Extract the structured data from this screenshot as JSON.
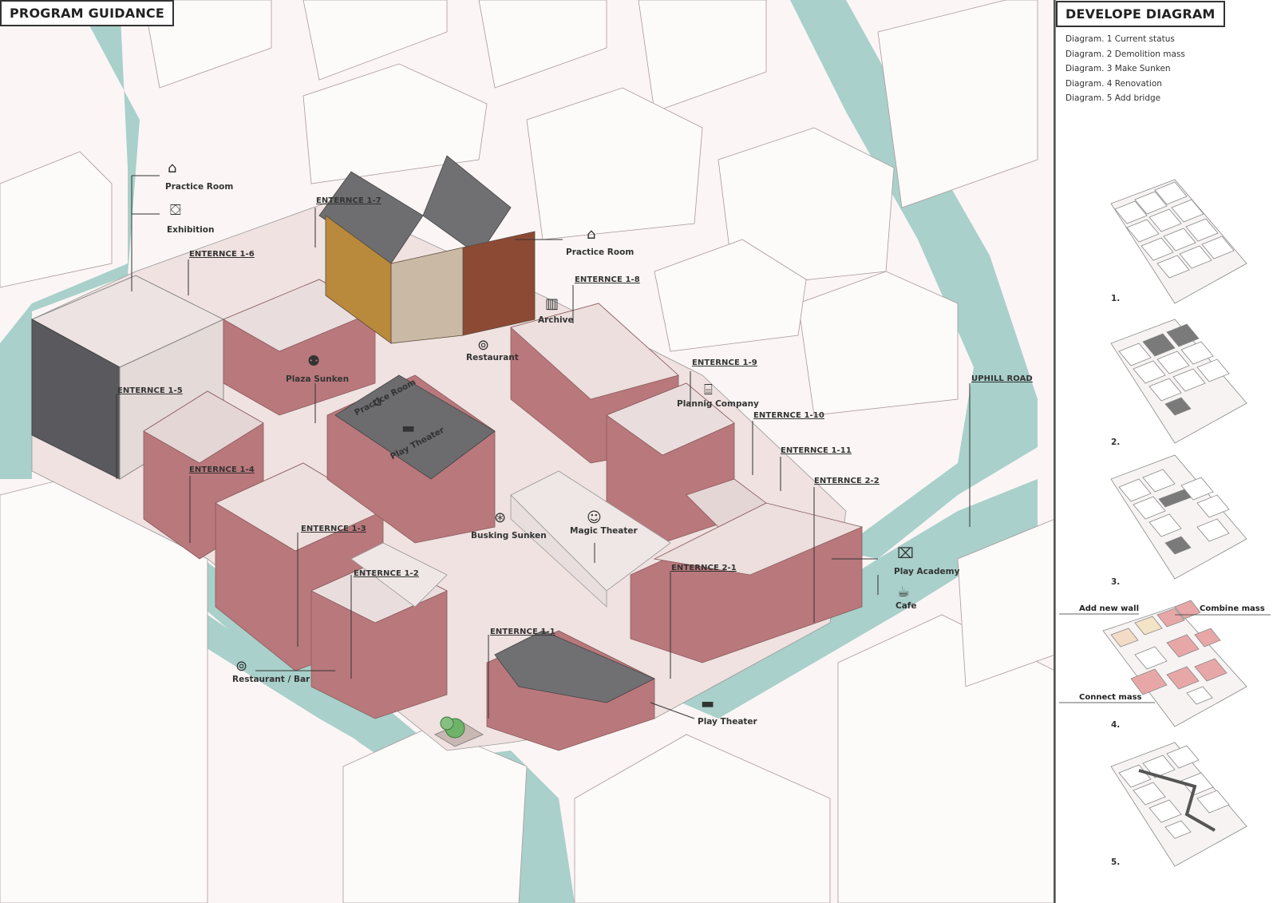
{
  "main_title": "PROGRAM GUIDANCE",
  "side_title": "DEVELOPE DIAGRAM",
  "diagram_list": [
    "Diagram. 1 Current status",
    "Diagram. 2 Demolition mass",
    "Diagram. 3 Make Sunken",
    "Diagram. 4 Renovation",
    "Diagram. 5 Add bridge"
  ],
  "diagram_numbers": [
    "1.",
    "2.",
    "3.",
    "4.",
    "5."
  ],
  "diagram4_annotations": {
    "add_new_wall": "Add new wall",
    "combine_mass": "Combine mass",
    "connect_mass": "Connect mass"
  },
  "entrances": {
    "e1_1": "ENTERNCE 1-1",
    "e1_2": "ENTERNCE 1-2",
    "e1_3": "ENTERNCE 1-3",
    "e1_4": "ENTERNCE 1-4",
    "e1_5": "ENTERNCE 1-5",
    "e1_6": "ENTERNCE 1-6",
    "e1_7": "ENTERNCE 1-7",
    "e1_8": "ENTERNCE 1-8",
    "e1_9": "ENTERNCE 1-9",
    "e1_10": "ENTERNCE 1-10",
    "e1_11": "ENTERNCE 1-11",
    "e2_1": "ENTERNCE 2-1",
    "e2_2": "ENTERNCE 2-2",
    "uphill": "UPHILL ROAD"
  },
  "programs": {
    "practice_room_a": "Practice Room",
    "exhibition": "Exhibition",
    "practice_room_b": "Practice Room",
    "archive": "Archive",
    "restaurant": "Restaurant",
    "plaza_sunken": "Plaza Sunken",
    "practice_room_c": "Practice Room",
    "play_theater_a": "Play Theater",
    "plannig_company": "Plannig Company",
    "busking_sunken": "Busking Sunken",
    "magic_theater": "Magic Theater",
    "play_academy": "Play Academy",
    "cafe": "Cafe",
    "restaurant_bar": "Restaurant / Bar",
    "play_theater_b": "Play Theater"
  },
  "colors": {
    "background": "#fbf5f5",
    "brick": "#b9787c",
    "roof": "#e9dedd",
    "metal_roof": "#6e6e70",
    "street": "#a9d0ca",
    "wood": "#b98a3c",
    "dark_brick": "#8c4a34",
    "highlight_mass": "#e8a7a7"
  }
}
